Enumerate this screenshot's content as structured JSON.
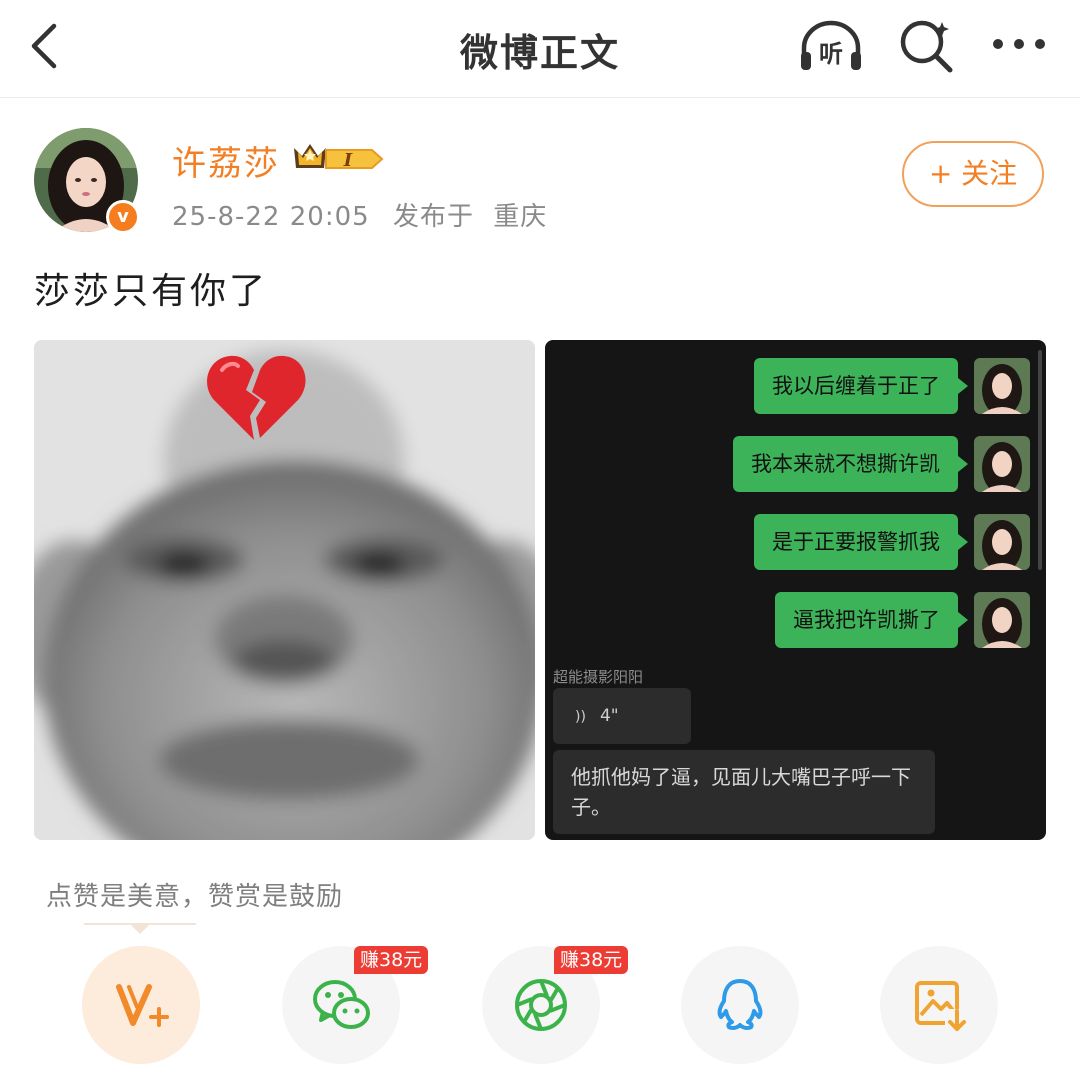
{
  "header": {
    "title": "微博正文",
    "back_icon": "chevron-left-icon",
    "listen_label": "听",
    "listen_icon": "headphones-icon",
    "search_icon": "search-icon",
    "more_icon": "more-dots-icon"
  },
  "post": {
    "author": {
      "name": "许荔莎",
      "verified_mark": "v",
      "level_label": "I",
      "level_icon": "crown-icon"
    },
    "date": "25-8-22 20:05",
    "location_prefix": "发布于",
    "location": "重庆",
    "follow_label": "+ 关注",
    "text": "莎莎只有你了",
    "images": {
      "left": {
        "description_icon": "broken-heart-icon"
      },
      "right": {
        "sent_messages": [
          "我以后缠着于正了",
          "我本来就不想撕许凯",
          "是于正要报警抓我",
          "逼我把许凯撕了"
        ],
        "received_sender": "超能摄影阳阳",
        "voice_duration": "4\"",
        "received_text": "他抓他妈了逼，见面儿大嘴巴子呼一下子。"
      }
    }
  },
  "reward": {
    "note": "点赞是美意，赞赏是鼓励"
  },
  "share": {
    "items": [
      {
        "name": "reward",
        "icon": "v-plus-icon"
      },
      {
        "name": "wechat",
        "icon": "wechat-icon",
        "badge": "赚38元"
      },
      {
        "name": "moments",
        "icon": "moments-icon",
        "badge": "赚38元"
      },
      {
        "name": "qq",
        "icon": "qq-icon"
      },
      {
        "name": "save-image",
        "icon": "save-image-icon"
      }
    ]
  },
  "colors": {
    "accent": "#f37f24",
    "chat_green": "#3db359",
    "badge_red": "#ec3c34",
    "wechat_green": "#3cb34a",
    "qq_blue": "#2d9be8",
    "save_orange": "#f0a330"
  }
}
